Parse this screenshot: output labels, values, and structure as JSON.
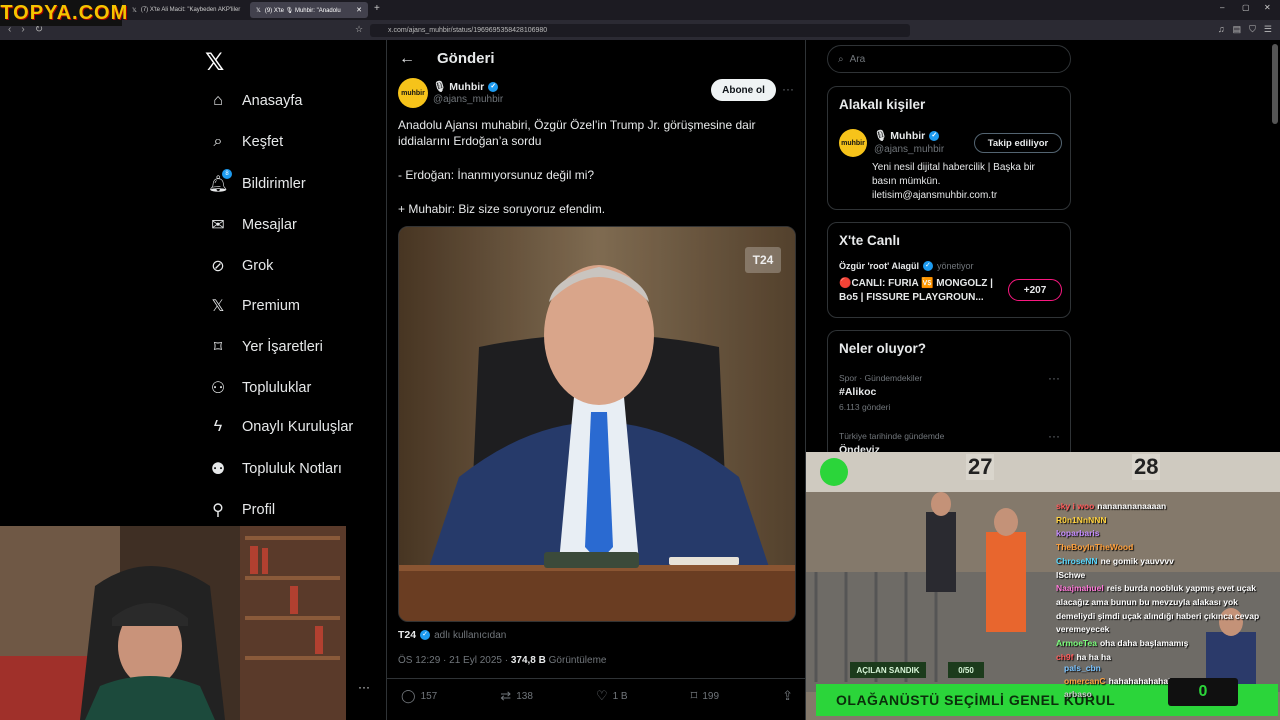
{
  "watermark": "iTOPYA.COM",
  "browser": {
    "tabs": [
      {
        "label": "(7) X'te Ali Macit: \"Kaybeden AKP'liler"
      },
      {
        "label": "(9) X'te 🎙 Muhbir: \"Anadolu"
      }
    ],
    "url": "x.com/ajans_muhbir/status/1969695358428106980",
    "new_tab": "+",
    "win_min": "–",
    "win_max": "▢",
    "win_close": "✕"
  },
  "nav": {
    "items": [
      {
        "label": "Anasayfa",
        "icon": "home-icon"
      },
      {
        "label": "Keşfet",
        "icon": "search-icon"
      },
      {
        "label": "Bildirimler",
        "icon": "bell-icon",
        "badge": "8"
      },
      {
        "label": "Mesajlar",
        "icon": "mail-icon"
      },
      {
        "label": "Grok",
        "icon": "grok-icon"
      },
      {
        "label": "Premium",
        "icon": "x-icon"
      },
      {
        "label": "Yer İşaretleri",
        "icon": "bookmark-icon"
      },
      {
        "label": "Topluluklar",
        "icon": "people-icon"
      },
      {
        "label": "Onaylı Kuruluşlar",
        "icon": "lightning-icon"
      },
      {
        "label": "Topluluk Notları",
        "icon": "notes-icon"
      },
      {
        "label": "Profil",
        "icon": "user-icon"
      }
    ]
  },
  "post": {
    "page_title": "Gönderi",
    "avatar_text": "muhbir",
    "author": "🎙 Muhbir",
    "handle": "@ajans_muhbir",
    "subscribe_label": "Abone ol",
    "text_lines": [
      "Anadolu Ajansı muhabiri, Özgür Özel’in Trump Jr. görüşmesine dair",
      "iddialarını Erdoğan’a sordu",
      "- Erdoğan: İnanmıyorsunuz değil mi?",
      "+ Muhabir: Biz size soruyoruz efendim."
    ],
    "media_watermark": "T24",
    "source_name": "T24",
    "source_suffix": "adlı kullanıcıdan",
    "time": "ÖS 12:29 · 21 Eyl 2025 · ",
    "views": "374,8 B",
    "views_label": " Görüntüleme",
    "replies": "157",
    "reposts": "138",
    "likes": "1 B",
    "bookmarks": "199"
  },
  "sidebar": {
    "search_placeholder": "Ara",
    "related": {
      "title": "Alakalı kişiler",
      "name": "🎙 Muhbir",
      "handle": "@ajans_muhbir",
      "follow_label": "Takip ediliyor",
      "bio": "Yeni nesil dijital habercilik | Başka bir basın mümkün. iletisim@ajansmuhbir.com.tr"
    },
    "live": {
      "title": "X'te Canlı",
      "host": "Özgür 'root' Alagül",
      "host_role": "yönetiyor",
      "text": "🔴CANLI: FURIA 🆚 MONGOLZ | Bo5 | FISSURE PLAYGROUN...",
      "count": "+207"
    },
    "trends": {
      "title": "Neler oluyor?",
      "items": [
        {
          "category": "Spor · Gündemdekiler",
          "name": "#Alikoc",
          "count": "6.113 gönderi"
        },
        {
          "category": "Türkiye tarihinde gündemde",
          "name": "Öndeviz",
          "count": ""
        }
      ]
    }
  },
  "stream": {
    "numbers": [
      "27",
      "28"
    ],
    "tag_left": "AÇILAN SANDIK",
    "tag_right": "0/50",
    "banner": "OLAĞANÜSTÜ SEÇİMLİ GENEL KURUL",
    "counter": "0",
    "chat": [
      {
        "name": "sky i woo",
        "msg": "nananananaaaan",
        "color": "#ff5c5c"
      },
      {
        "name": "R0n1NnNNN",
        "msg": "",
        "color": "#ffd23f"
      },
      {
        "name": "koparbaris",
        "msg": "",
        "color": "#c58cff"
      },
      {
        "name": "TheBoyInTheWood",
        "msg": "",
        "color": "#ffa23f"
      },
      {
        "name": "ChroseNN",
        "msg": "ne gomik yauvvvv",
        "color": "#58d8ff"
      },
      {
        "name": "lSchwe",
        "msg": "",
        "color": "#ffffff"
      },
      {
        "name": "Naajmahuel",
        "msg": "reis burda noobluk yapmış evet uçak alacağız ama bunun bu mevzuyla alakası yok demeliydi şimdi uçak alındığı haberi çıkınca cevap veremeyecek",
        "color": "#ff7ad9"
      },
      {
        "name": "ArmoeTea",
        "msg": "oha daha başlamamış",
        "color": "#7cff7c"
      },
      {
        "name": "ch9f",
        "msg": "ha ha ha",
        "color": "#ff5c5c"
      },
      {
        "name": "pals_cbn",
        "msg": "",
        "color": "#7cc4ff"
      },
      {
        "name": "omercanC",
        "msg": "hahahahahahaha",
        "color": "#ffa23f"
      },
      {
        "name": "arbaso",
        "msg": "",
        "color": "#cccccc"
      }
    ]
  },
  "colors": {
    "accent": "#1d9bf0",
    "background": "#000000",
    "border": "#2f3336",
    "banner_green": "#2bd53a"
  }
}
